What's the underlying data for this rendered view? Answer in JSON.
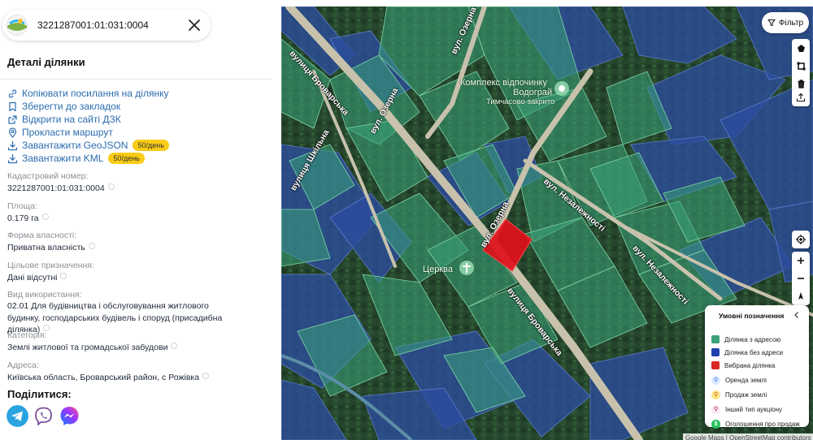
{
  "search": {
    "value": "3221287001:01:031:0004"
  },
  "details": {
    "title": "Деталі ділянки",
    "actions": [
      {
        "label": "Копіювати посилання на ділянку",
        "icon": "link-icon"
      },
      {
        "label": "Зберегти до закладок",
        "icon": "bookmark-icon"
      },
      {
        "label": "Відкрити на сайті ДЗК",
        "icon": "external-link-icon"
      },
      {
        "label": "Прокласти маршрут",
        "icon": "map-pin-icon"
      },
      {
        "label": "Завантажити GeoJSON",
        "icon": "download-icon",
        "badge": "50/день"
      },
      {
        "label": "Завантажити KML",
        "icon": "download-icon",
        "badge": "50/день"
      }
    ],
    "fields": [
      {
        "label": "Кадастровий номер:",
        "value": "3221287001:01:031:0004"
      },
      {
        "label": "Площа:",
        "value": "0.179 га"
      },
      {
        "label": "Форма власності:",
        "value": "Приватна власність"
      },
      {
        "label": "Цільове призначення:",
        "value": "Дані відсутні"
      },
      {
        "label": "Вид використання:",
        "value": "02.01 Для будівництва і обслуговування житлового будинку, господарських будівель і споруд (присадибна ділянка)"
      },
      {
        "label": "Категорія:",
        "value": "Землі житлової та громадської забудови"
      },
      {
        "label": "Адреса:",
        "value": "Київська область, Броварський район, с Рожівка"
      }
    ],
    "share_title": "Поділитися:"
  },
  "share": [
    {
      "name": "telegram",
      "color": "#2aa3df"
    },
    {
      "name": "viber",
      "color": "#7b519d"
    },
    {
      "name": "messenger",
      "color": "#0a7cff"
    }
  ],
  "map": {
    "filter_label": "Фільтр",
    "streets": [
      {
        "text": "вулиця Броварська"
      },
      {
        "text": "вулиця Броварська"
      },
      {
        "text": "вулиця Шкільна"
      },
      {
        "text": "вул. Озерна"
      },
      {
        "text": "вул. Озерна"
      },
      {
        "text": "вул. Озерна"
      },
      {
        "text": "вул. Незалежності"
      },
      {
        "text": "вул. Незалежності"
      }
    ],
    "poi": {
      "resort_name": "Комплекс відпочинку",
      "resort_name2": "Водограй",
      "resort_status": "Тимчасово закрито",
      "church": "Церква"
    },
    "attribution": "Google Maps | OpenStreetMap contributors"
  },
  "legend": {
    "title": "Умовні позначення",
    "items": [
      {
        "label": "Ділянка з адресою",
        "color": "#3aa37a",
        "kind": "square"
      },
      {
        "label": "Ділянка без адреси",
        "color": "#1e40af",
        "kind": "square"
      },
      {
        "label": "Вибрана ділянка",
        "color": "#dc2626",
        "kind": "square"
      },
      {
        "label": "Оренда землі",
        "color": "#dbeafe",
        "kind": "circle",
        "icon": "rent-icon"
      },
      {
        "label": "Продаж землі",
        "color": "#fde68a",
        "kind": "circle",
        "icon": "sale-icon"
      },
      {
        "label": "Інший тип аукціону",
        "color": "#fce7f3",
        "kind": "circle",
        "icon": "auction-icon"
      },
      {
        "label": "Оголошення про продаж",
        "color": "#22c55e",
        "kind": "circle",
        "icon": "announcement-icon"
      }
    ]
  }
}
